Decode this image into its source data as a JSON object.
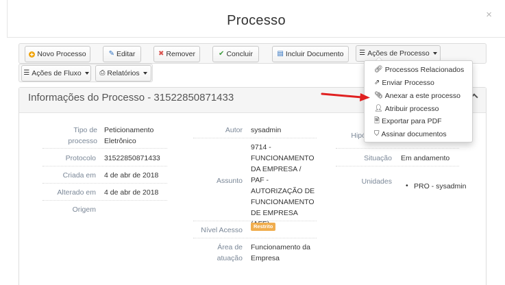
{
  "modal": {
    "title": "Processo",
    "close_glyph": "×"
  },
  "toolbar": {
    "novo": "Novo Processo",
    "editar": "Editar",
    "remover": "Remover",
    "concluir": "Concluir",
    "incluir": "Incluir Documento",
    "acoes_processo": "Ações de Processo",
    "acoes_fluxo": "Ações de Fluxo",
    "relatorios": "Relatórios"
  },
  "dropdown": {
    "items": [
      "Processos Relacionados",
      "Enviar Processo",
      "Anexar a este processo",
      "Atribuir processo",
      "Exportar para PDF",
      "Assinar documentos"
    ]
  },
  "panel": {
    "title": "Informações do Processo - 31522850871433",
    "left": {
      "tipo_label": "Tipo de processo",
      "tipo_value": "Peticionamento Eletrônico",
      "protocolo_label": "Protocolo",
      "protocolo_value": "31522850871433",
      "criada_label": "Criada em",
      "criada_value": "4 de abr de 2018",
      "alterado_label": "Alterado em",
      "alterado_value": "4 de abr de 2018",
      "origem_label": "Origem"
    },
    "middle": {
      "autor_label": "Autor",
      "autor_value": "sysadmin",
      "assunto_label": "Assunto",
      "assunto_value": "9714 - FUNCIONAMENTO DA EMPRESA / PAF - AUTORIZAÇÃO DE FUNCIONAMENTO DE EMPRESA (AFE)",
      "nivel_label": "Nível Acesso",
      "nivel_value": "Restrito",
      "area_label": "Área de atuação",
      "area_value": "Funcionamento da Empresa"
    },
    "right": {
      "hipotese_label": "Hipó",
      "situacao_label": "Situação",
      "situacao_value": "Em andamento",
      "unidades_label": "Unidades",
      "unidades_value": "PRO - sysadmin"
    }
  },
  "colors": {
    "arrow": "#e02020",
    "badge": "#f0ad4e",
    "label": "#7a8797"
  }
}
